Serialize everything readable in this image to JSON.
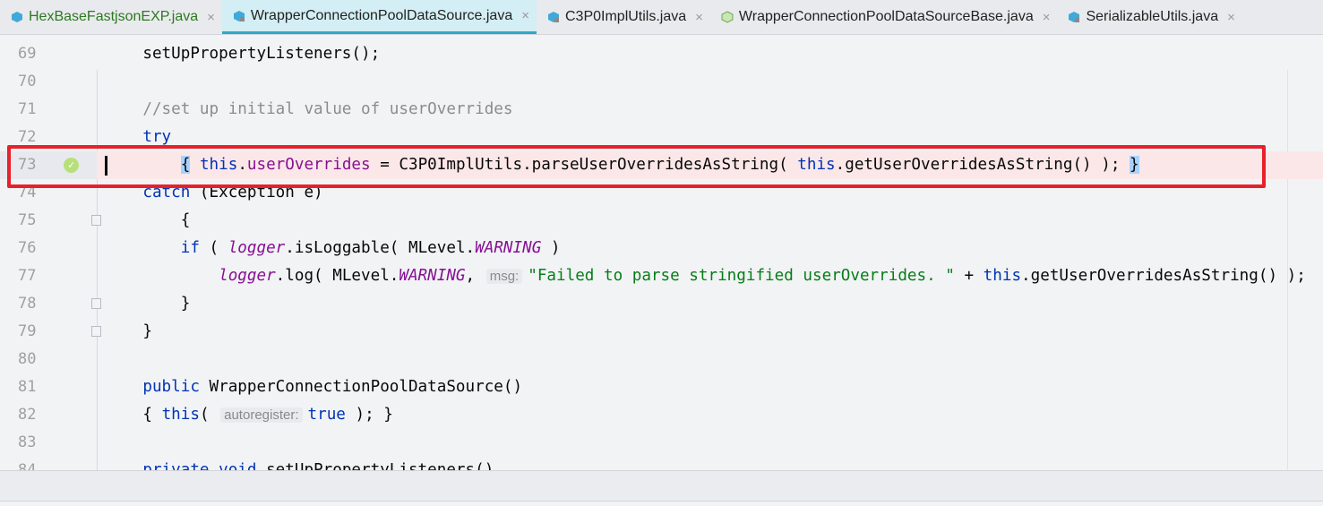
{
  "tabs": [
    {
      "label": "HexBaseFastjsonEXP.java",
      "active": false,
      "color": "#2b7a1f",
      "icon": "java-class-icon"
    },
    {
      "label": "WrapperConnectionPoolDataSource.java",
      "active": true,
      "icon": "java-class-icon"
    },
    {
      "label": "C3P0ImplUtils.java",
      "active": false,
      "icon": "java-class-icon"
    },
    {
      "label": "WrapperConnectionPoolDataSourceBase.java",
      "active": false,
      "icon": "abstract-class-icon"
    },
    {
      "label": "SerializableUtils.java",
      "active": false,
      "icon": "java-class-icon"
    }
  ],
  "close_glyph": "×",
  "highlight_line": 73,
  "lines": [
    {
      "n": "69",
      "t": [
        [
          "",
          "    setUpPropertyListeners();"
        ]
      ]
    },
    {
      "n": "70",
      "t": []
    },
    {
      "n": "71",
      "t": [
        [
          "cmt",
          "    //set up initial value of userOverrides"
        ]
      ]
    },
    {
      "n": "72",
      "t": [
        [
          "kw",
          "    try"
        ]
      ]
    },
    {
      "n": "73",
      "t": [
        [
          "",
          "        "
        ],
        [
          "brace",
          "{"
        ],
        [
          "",
          " "
        ],
        [
          "kw",
          "this"
        ],
        [
          "",
          "."
        ],
        [
          "fld",
          "userOverrides"
        ],
        [
          "",
          " = C3P0ImplUtils.parseUserOverridesAsString( "
        ],
        [
          "kw",
          "this"
        ],
        [
          "",
          ".getUserOverridesAsString() ); "
        ],
        [
          "brace",
          "}"
        ]
      ]
    },
    {
      "n": "74",
      "t": [
        [
          "kw",
          "    catch"
        ],
        [
          "",
          " (Exception e)"
        ]
      ]
    },
    {
      "n": "75",
      "t": [
        [
          "",
          "        {"
        ]
      ]
    },
    {
      "n": "76",
      "t": [
        [
          "kw",
          "        if"
        ],
        [
          "",
          " ( "
        ],
        [
          "st",
          "logger"
        ],
        [
          "",
          ".isLoggable( MLevel."
        ],
        [
          "st",
          "WARNING"
        ],
        [
          "",
          " )"
        ]
      ]
    },
    {
      "n": "77",
      "t": [
        [
          "",
          "            "
        ],
        [
          "st",
          "logger"
        ],
        [
          "",
          ".log( MLevel."
        ],
        [
          "st",
          "WARNING"
        ],
        [
          "",
          ", "
        ],
        [
          "hint",
          "msg:"
        ],
        [
          "str",
          "\"Failed to parse stringified userOverrides. \""
        ],
        [
          "",
          " + "
        ],
        [
          "kw",
          "this"
        ],
        [
          "",
          ".getUserOverridesAsString() );"
        ]
      ]
    },
    {
      "n": "78",
      "t": [
        [
          "",
          "        }"
        ]
      ]
    },
    {
      "n": "79",
      "t": [
        [
          "",
          "    }"
        ]
      ]
    },
    {
      "n": "80",
      "t": []
    },
    {
      "n": "81",
      "t": [
        [
          "kw",
          "    public"
        ],
        [
          "",
          " WrapperConnectionPoolDataSource()"
        ]
      ]
    },
    {
      "n": "82",
      "t": [
        [
          "",
          "    { "
        ],
        [
          "kw",
          "this"
        ],
        [
          "",
          "( "
        ],
        [
          "hint",
          "autoregister:"
        ],
        [
          "kw",
          "true"
        ],
        [
          "",
          " ); }"
        ]
      ]
    },
    {
      "n": "83",
      "t": []
    },
    {
      "n": "84",
      "t": [
        [
          "kw",
          "    private void"
        ],
        [
          "",
          " setUpPropertyListeners()"
        ]
      ]
    }
  ]
}
